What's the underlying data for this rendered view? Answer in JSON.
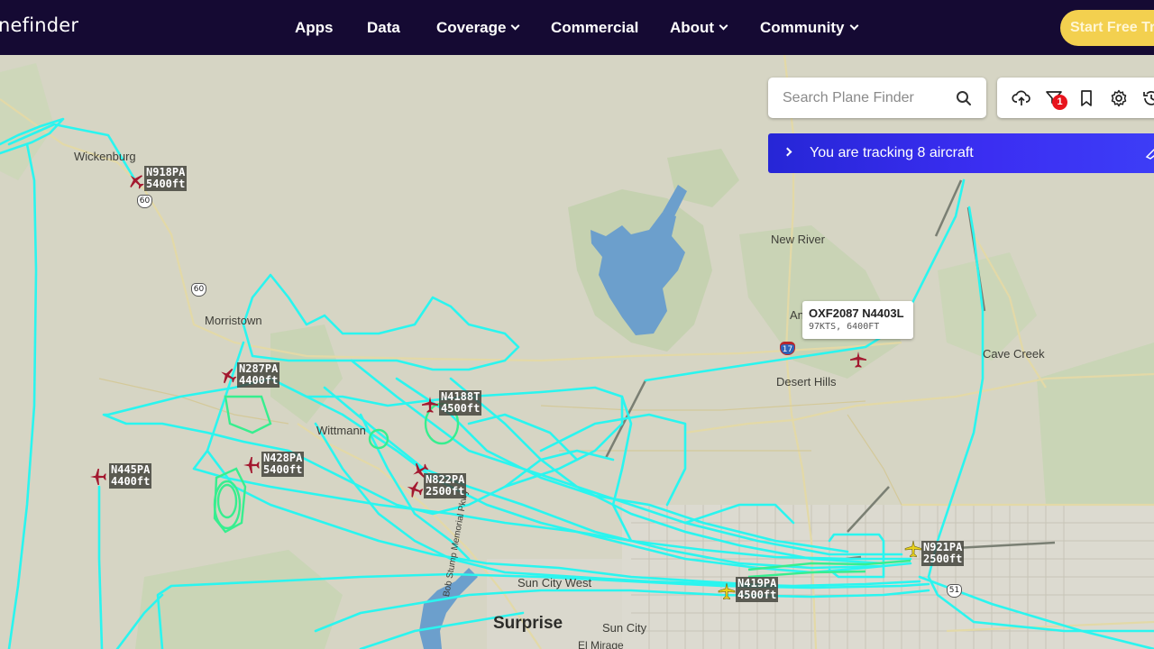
{
  "nav": {
    "logo": "nefinder",
    "links": [
      {
        "label": "Apps",
        "dropdown": false
      },
      {
        "label": "Data",
        "dropdown": false
      },
      {
        "label": "Coverage",
        "dropdown": true
      },
      {
        "label": "Commercial",
        "dropdown": false
      },
      {
        "label": "About",
        "dropdown": true
      },
      {
        "label": "Community",
        "dropdown": true
      }
    ],
    "cta_label": "Start Free Tr"
  },
  "search": {
    "placeholder": "Search Plane Finder"
  },
  "toolbar": {
    "tools": [
      "cloud-upload-icon",
      "filter-icon",
      "bookmark-icon",
      "settings-icon",
      "history-icon"
    ],
    "filter_badge": "1"
  },
  "tracking_banner": {
    "text": "You are tracking 8 aircraft"
  },
  "selected_popup": {
    "title": "OXF2087 N4403L",
    "subtitle": "97KTS, 6400FT"
  },
  "places": [
    {
      "name": "Wickenburg"
    },
    {
      "name": "Morristown"
    },
    {
      "name": "Wittmann"
    },
    {
      "name": "New River"
    },
    {
      "name": "An"
    },
    {
      "name": "Desert Hills"
    },
    {
      "name": "Cave Creek"
    },
    {
      "name": "Sun City West"
    },
    {
      "name": "Surprise"
    },
    {
      "name": "Sun City"
    },
    {
      "name": "El Mirage"
    },
    {
      "name": "Bob Stump Memorial Pkwy"
    }
  ],
  "road_shields": [
    "60",
    "60",
    "17",
    "51"
  ],
  "aircraft": [
    {
      "callsign": "N918PA",
      "altitude": "5400ft",
      "color": "#a3182f"
    },
    {
      "callsign": "N287PA",
      "altitude": "4400ft",
      "color": "#a3182f"
    },
    {
      "callsign": "N4188T",
      "altitude": "4500ft",
      "color": "#a3182f"
    },
    {
      "callsign": "N428PA",
      "altitude": "5400ft",
      "color": "#a3182f"
    },
    {
      "callsign": "N445PA",
      "altitude": "4400ft",
      "color": "#a3182f"
    },
    {
      "callsign": "N822PA",
      "altitude": "2500ft",
      "color": "#a3182f"
    },
    {
      "callsign": "N921PA",
      "altitude": "2500ft",
      "color": "#e9d21a"
    },
    {
      "callsign": "N419PA",
      "altitude": "4500ft",
      "color": "#e9d21a"
    },
    {
      "callsign": "N4403L",
      "altitude": "",
      "color": "#a3182f"
    }
  ],
  "colors": {
    "track": "#2af5ef",
    "track_low": "#37ee8f",
    "nav_bg": "#150a33",
    "cta": "#f3d04f",
    "banner": "#3b2ef2",
    "lake": "#6c9fcc"
  }
}
